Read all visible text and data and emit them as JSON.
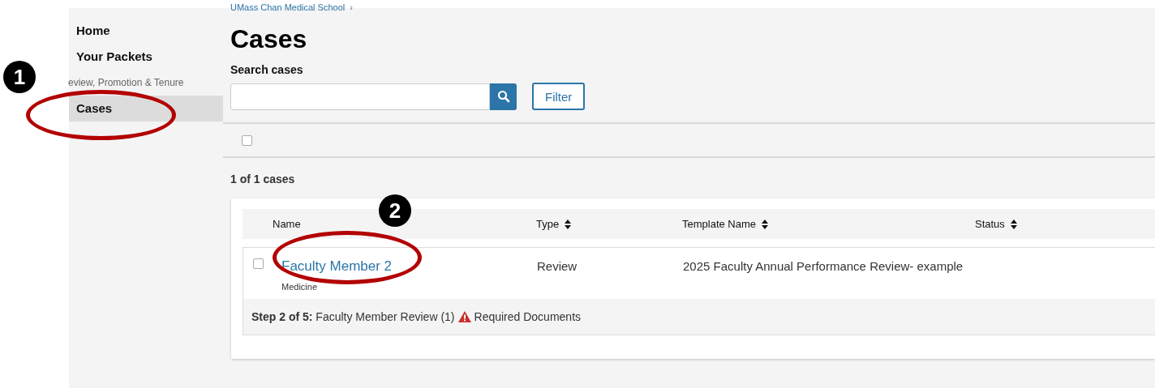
{
  "breadcrumb": "UMass Chan Medical School",
  "breadcrumb_separator": "›",
  "sidebar": {
    "items": [
      {
        "label": "Home",
        "kind": "link",
        "selected": false
      },
      {
        "label": "Your Packets",
        "kind": "link",
        "selected": false
      },
      {
        "label": "eview, Promotion & Tenure",
        "kind": "section",
        "selected": false
      },
      {
        "label": "Cases",
        "kind": "link",
        "selected": true
      }
    ]
  },
  "page_title": "Cases",
  "search": {
    "label": "Search cases"
  },
  "filter_button": "Filter",
  "select_all": {
    "checked": false
  },
  "count": "1 of 1 cases",
  "table": {
    "columns": [
      {
        "label": "Name",
        "sortable": false
      },
      {
        "label": "Type",
        "sortable": true
      },
      {
        "label": "Template Name",
        "sortable": true
      },
      {
        "label": "Status",
        "sortable": true
      }
    ],
    "rows": [
      {
        "checked": false,
        "name": "Faculty Member 2",
        "department": "Medicine",
        "type": "Review",
        "template": "2025 Faculty Annual Performance Review- example",
        "step_label": "Step 2 of 5:",
        "step_text": "Faculty Member Review (1)",
        "warning": "Required Documents"
      }
    ]
  },
  "annotations": [
    {
      "number": "1"
    },
    {
      "number": "2"
    }
  ]
}
